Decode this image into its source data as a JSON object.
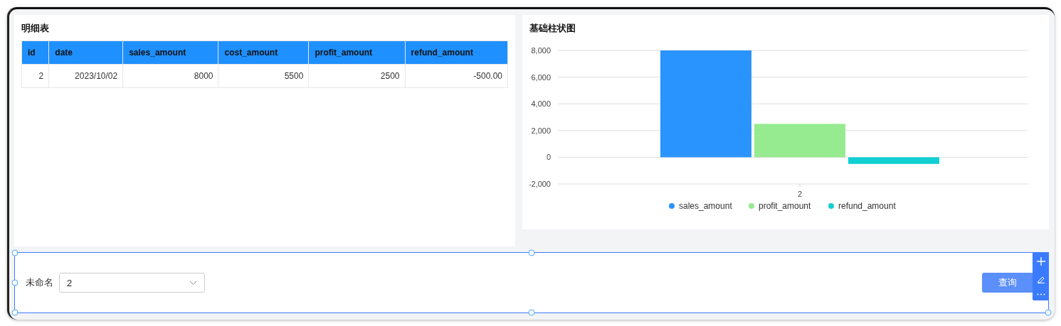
{
  "table_panel": {
    "title": "明细表",
    "columns": [
      "id",
      "date",
      "sales_amount",
      "cost_amount",
      "profit_amount",
      "refund_amount"
    ],
    "rows": [
      [
        "2",
        "2023/10/02",
        "8000",
        "5500",
        "2500",
        "-500.00"
      ]
    ]
  },
  "chart_panel": {
    "title": "基础柱状图",
    "chart_data": {
      "type": "bar",
      "grid": true,
      "legend": "bottom",
      "categories": [
        "2"
      ],
      "ylim": [
        -2000,
        8000
      ],
      "yticks": [
        {
          "value": -2000,
          "label": "-2,000"
        },
        {
          "value": 0,
          "label": "0"
        },
        {
          "value": 2000,
          "label": "2,000"
        },
        {
          "value": 4000,
          "label": "4,000"
        },
        {
          "value": 6000,
          "label": "6,000"
        },
        {
          "value": 8000,
          "label": "8,000"
        }
      ],
      "series": [
        {
          "name": "sales_amount",
          "color": "#2a94fe",
          "values": [
            8000
          ]
        },
        {
          "name": "profit_amount",
          "color": "#96eb90",
          "values": [
            2500
          ]
        },
        {
          "name": "refund_amount",
          "color": "#11cfd3",
          "values": [
            -500
          ]
        }
      ]
    }
  },
  "filter_bar": {
    "selected": true,
    "label": "未命名",
    "select_value": "2",
    "button": "查询"
  }
}
